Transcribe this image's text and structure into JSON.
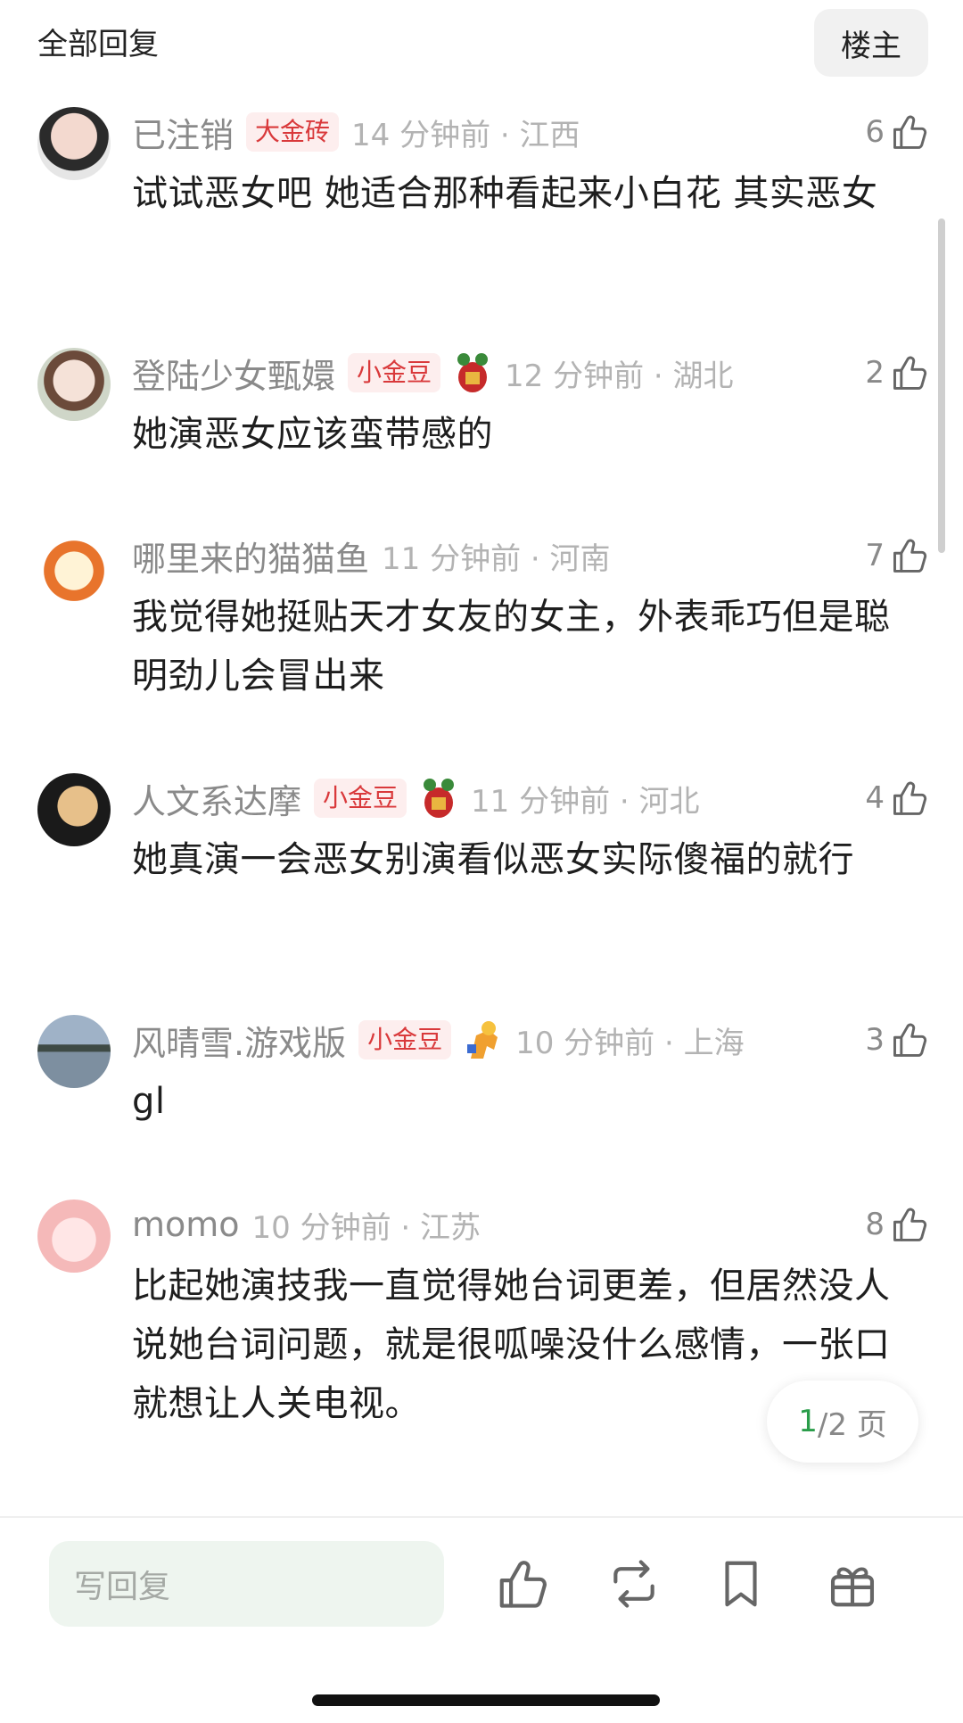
{
  "header": {
    "title": "全部回复",
    "louzhu_label": "楼主"
  },
  "comments": [
    {
      "username": "已注销",
      "badge": "大金砖",
      "time": "14 分钟前 · 江西",
      "likes": "6",
      "content": "试试恶女吧 她适合那种看起来小白花 其实恶女"
    },
    {
      "username": "登陆少女甄嬛",
      "badge": "小金豆",
      "time": "12 分钟前 · 湖北",
      "likes": "2",
      "content": "她演恶女应该蛮带感的"
    },
    {
      "username": "哪里来的猫猫鱼",
      "time": "11 分钟前 · 河南",
      "likes": "7",
      "content": "我觉得她挺贴天才女友的女主，外表乖巧但是聪明劲儿会冒出来"
    },
    {
      "username": "人文系达摩",
      "badge": "小金豆",
      "time": "11 分钟前 · 河北",
      "likes": "4",
      "content": "她真演一会恶女别演看似恶女实际傻福的就行"
    },
    {
      "username": "风晴雪.游戏版",
      "badge": "小金豆",
      "time": "10 分钟前 · 上海",
      "likes": "3",
      "content": "gl"
    },
    {
      "username": "momo",
      "time": "10 分钟前 · 江苏",
      "likes": "8",
      "content": "比起她演技我一直觉得她台词更差，但居然没人说她台词问题，就是很呱噪没什么感情，一张口就想让人关电视。"
    }
  ],
  "pager": {
    "current": "1",
    "rest": "/2 页"
  },
  "bottom_bar": {
    "reply_placeholder": "写回复",
    "icons": [
      "thumbs-up-icon",
      "repost-icon",
      "bookmark-icon",
      "gift-icon"
    ]
  },
  "colors": {
    "badge_bg": "#fdeeee",
    "badge_text": "#d9393b",
    "pager_current": "#2a9d4a",
    "reply_box_bg": "#eef5ef"
  }
}
